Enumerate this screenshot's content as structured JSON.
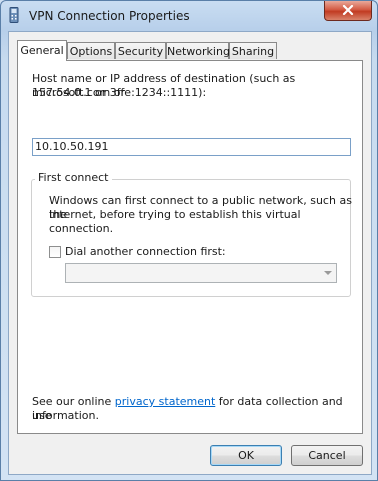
{
  "window": {
    "title": "VPN Connection Properties"
  },
  "tabs": [
    {
      "label": "General",
      "active": true
    },
    {
      "label": "Options",
      "active": false
    },
    {
      "label": "Security",
      "active": false
    },
    {
      "label": "Networking",
      "active": false
    },
    {
      "label": "Sharing",
      "active": false
    }
  ],
  "general": {
    "host_label_line1": "Host name or IP address of destination (such as microsoft.com or",
    "host_label_line2": "157.54.0.1 or 3ffe:1234::1111):",
    "host_value": "10.10.50.191",
    "first_connect": {
      "title": "First connect",
      "description_line1": "Windows can first connect to a public network, such as the",
      "description_line2": "Internet, before trying to establish this virtual connection.",
      "dial_label": "Dial another connection first:",
      "dial_checked": false,
      "combo_value": ""
    },
    "privacy": {
      "prefix": "See our online ",
      "link": "privacy statement",
      "suffix": " for data collection and use",
      "line2": "information."
    }
  },
  "buttons": {
    "ok": "OK",
    "cancel": "Cancel"
  },
  "icons": {
    "title_icon": "vpn-phone-icon",
    "close": "close-icon"
  },
  "colors": {
    "link": "#0066cc",
    "close_button": "#c13b22"
  }
}
